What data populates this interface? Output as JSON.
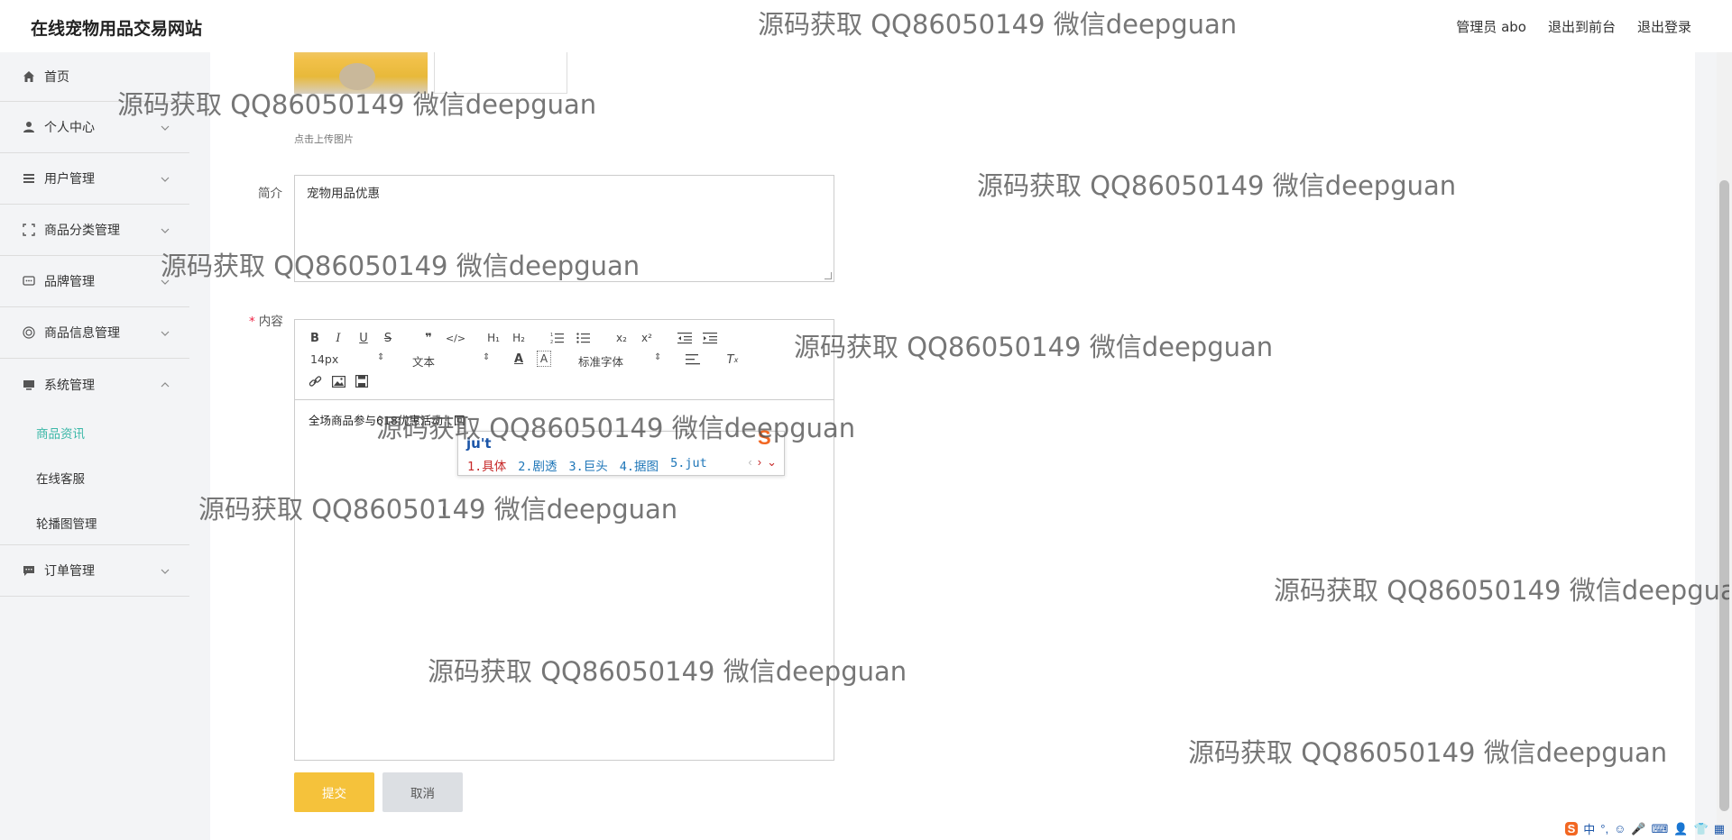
{
  "header": {
    "site_title": "在线宠物用品交易网站",
    "admin_label": "管理员 abo",
    "back_front": "退出到前台",
    "logout": "退出登录"
  },
  "sidebar": {
    "items": [
      {
        "label": "首页",
        "icon": "home-icon"
      },
      {
        "label": "个人中心",
        "icon": "user-icon"
      },
      {
        "label": "用户管理",
        "icon": "list-icon"
      },
      {
        "label": "商品分类管理",
        "icon": "scan-icon"
      },
      {
        "label": "品牌管理",
        "icon": "chat-icon"
      },
      {
        "label": "商品信息管理",
        "icon": "target-icon"
      },
      {
        "label": "系统管理",
        "icon": "monitor-icon"
      },
      {
        "label": "订单管理",
        "icon": "message-icon"
      }
    ],
    "sub_items": [
      {
        "label": "商品资讯",
        "active": true
      },
      {
        "label": "在线客服",
        "active": false
      },
      {
        "label": "轮播图管理",
        "active": false
      }
    ]
  },
  "form": {
    "upload_hint": "点击上传图片",
    "intro_label": "简介",
    "intro_value": "宠物用品优惠",
    "content_label": "内容",
    "content_required_mark": "*",
    "content_value": "全场商品参与618优惠活动 | 回",
    "submit_label": "提交",
    "cancel_label": "取消"
  },
  "editor": {
    "font_size": "14px",
    "text_style": "文本",
    "font_family": "标准字体"
  },
  "ime": {
    "input": "ju't",
    "candidates": [
      "1.具体",
      "2.剧透",
      "3.巨头",
      "4.据图",
      "5.jut"
    ]
  },
  "watermark": "源码获取 QQ86050149 微信deepguan",
  "tray": {
    "items": [
      "中",
      "°,"
    ]
  },
  "colors": {
    "accent": "#3cb8a8",
    "submit": "#f5c23b",
    "cancel": "#dcdfe3"
  }
}
